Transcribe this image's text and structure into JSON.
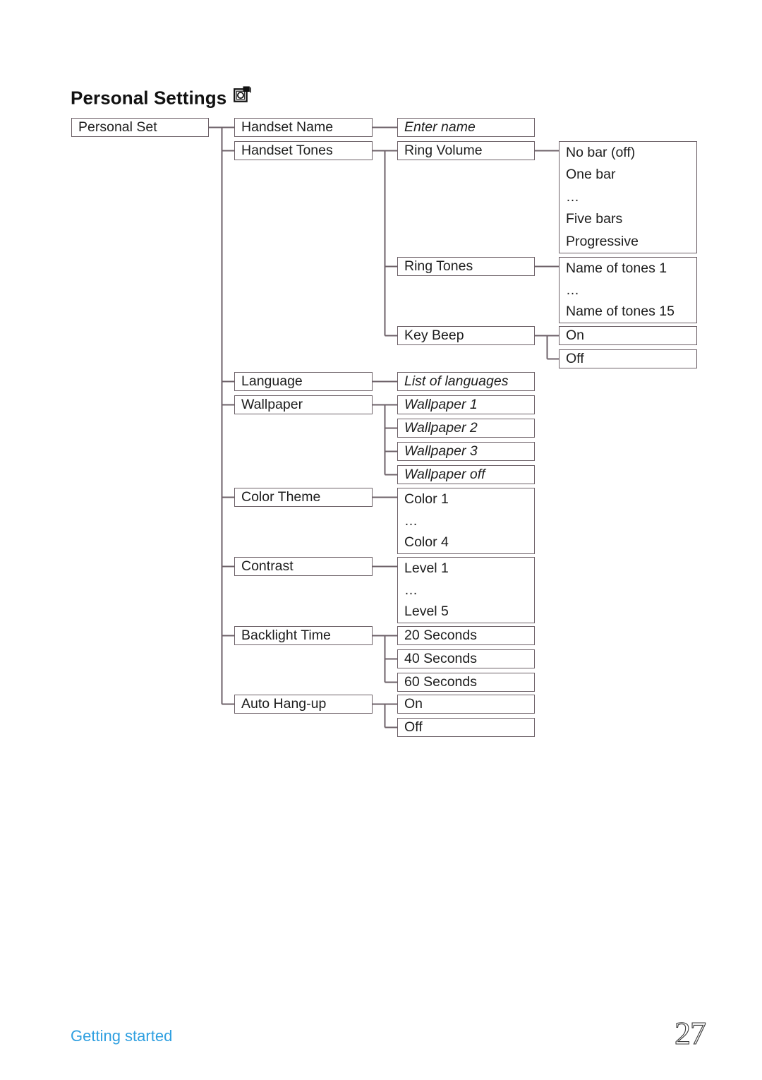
{
  "page": {
    "title": "Personal Settings",
    "title_icon": "personal-settings-icon",
    "footer_label": "Getting started",
    "page_number": "27",
    "footer_color": "#2e9fe0",
    "box_border_color": "#6d6168",
    "connector_color": "#6d6168"
  },
  "tree": {
    "root": {
      "label": "Personal Set"
    },
    "level1": [
      {
        "label": "Handset Name"
      },
      {
        "label": "Handset Tones"
      },
      {
        "label": "Language"
      },
      {
        "label": "Wallpaper"
      },
      {
        "label": "Color Theme"
      },
      {
        "label": "Contrast"
      },
      {
        "label": "Backlight Time"
      },
      {
        "label": "Auto Hang-up"
      }
    ],
    "handset_name_child": {
      "label": "Enter name",
      "italic": true
    },
    "handset_tones_children": [
      {
        "label": "Ring Volume"
      },
      {
        "label": "Ring Tones"
      },
      {
        "label": "Key Beep"
      }
    ],
    "ring_volume_options": [
      "No bar (off)",
      "One bar",
      "…",
      "Five bars",
      "Progressive"
    ],
    "ring_tones_options": [
      "Name of tones 1",
      "…",
      "Name of tones 15"
    ],
    "key_beep_options": [
      {
        "label": "On"
      },
      {
        "label": "Off"
      }
    ],
    "language_child": {
      "label": "List of languages",
      "italic": true
    },
    "wallpaper_children": [
      {
        "label": "Wallpaper 1",
        "italic": true
      },
      {
        "label": "Wallpaper 2",
        "italic": true
      },
      {
        "label": "Wallpaper 3",
        "italic": true
      },
      {
        "label": "Wallpaper off",
        "italic": true
      }
    ],
    "color_theme_options": [
      "Color 1",
      "…",
      "Color 4"
    ],
    "contrast_options": [
      "Level 1",
      "…",
      "Level 5"
    ],
    "backlight_children": [
      {
        "label": "20 Seconds"
      },
      {
        "label": "40 Seconds"
      },
      {
        "label": "60 Seconds"
      }
    ],
    "auto_hangup_children": [
      {
        "label": "On"
      },
      {
        "label": "Off"
      }
    ]
  }
}
